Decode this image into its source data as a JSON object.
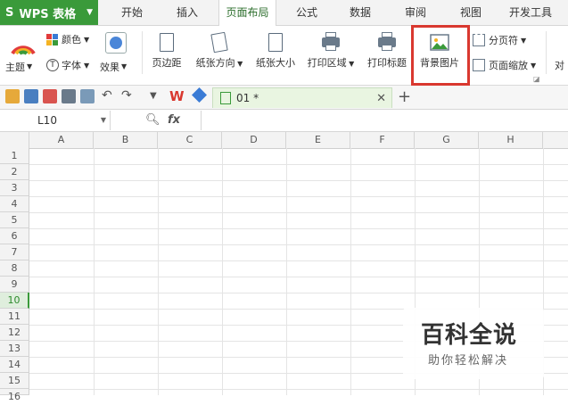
{
  "app": {
    "logo": "S",
    "title": "WPS 表格"
  },
  "menu_tabs": [
    "开始",
    "插入",
    "页面布局",
    "公式",
    "数据",
    "审阅",
    "视图",
    "开发工具"
  ],
  "active_menu_tab": "页面布局",
  "ribbon": {
    "theme": "主题",
    "color": "颜色",
    "font": "字体",
    "effect": "效果",
    "margins": "页边距",
    "orientation": "纸张方向",
    "paper_size": "纸张大小",
    "print_area": "打印区域",
    "print_titles": "打印标题",
    "background_image": "背景图片",
    "page_break": "分页符",
    "page_zoom": "页面缩放",
    "align_partial": "对"
  },
  "document_tab": {
    "name": "01 *"
  },
  "name_box": "L10",
  "formula_fx": "fx",
  "columns": [
    "A",
    "B",
    "C",
    "D",
    "E",
    "F",
    "G",
    "H"
  ],
  "rows": [
    "1",
    "2",
    "3",
    "4",
    "5",
    "6",
    "7",
    "8",
    "9",
    "10",
    "11",
    "12",
    "13",
    "14",
    "15",
    "16"
  ],
  "active_row": "10",
  "highlight_color": "#d9382f",
  "accent_color": "#3a9a3a",
  "watermark": {
    "title": "百科全说",
    "subtitle": "助你轻松解决"
  }
}
